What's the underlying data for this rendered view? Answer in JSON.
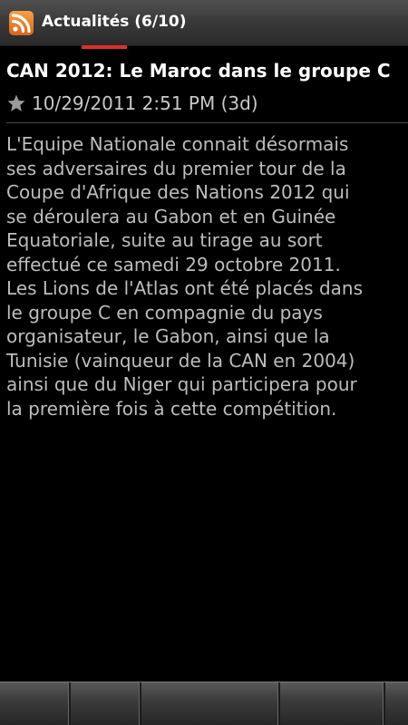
{
  "titlebar": {
    "title": "Actualités (6/10)",
    "icon": "rss-icon",
    "accent_color": "#e0302a"
  },
  "article": {
    "title": "CAN 2012: Le Maroc dans le groupe C",
    "favorite_icon": "star-icon",
    "date": "10/29/2011 2:51 PM (3d)",
    "body_lines": [
      "L'Equipe Nationale connait désormais",
      "ses adversaires du premier tour de la",
      "Coupe d'Afrique des Nations 2012 qui",
      "se déroulera au Gabon et en Guinée",
      "Equatoriale, suite au tirage au sort",
      "effectué ce samedi 29 octobre 2011.",
      "Les Lions de l'Atlas ont été placés dans",
      "le groupe C en compagnie du pays",
      "organisateur, le Gabon, ainsi que la",
      "Tunisie (vainqueur de la CAN en 2004)",
      "ainsi que du Niger qui participera pour",
      "la première fois à cette compétition."
    ]
  },
  "bottom_bar": {
    "tabs": [
      "",
      "",
      "",
      "",
      ""
    ]
  }
}
